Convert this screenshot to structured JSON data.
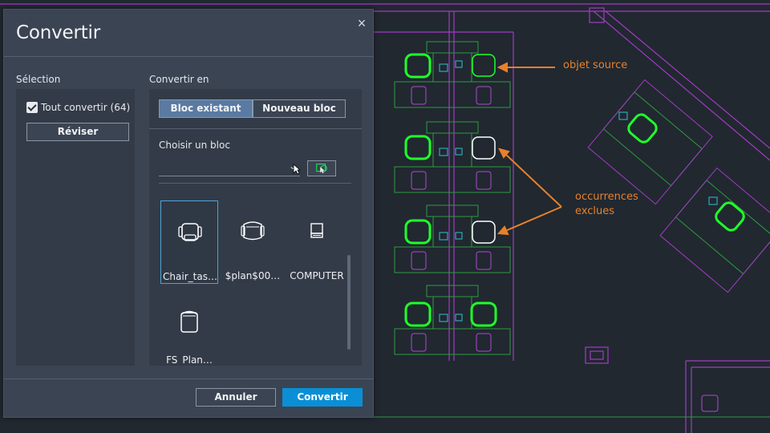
{
  "dialog": {
    "title": "Convertir",
    "close_glyph": "×",
    "selection_label": "Sélection",
    "convert_to_label": "Convertir en",
    "convert_all_label": "Tout convertir (64)",
    "convert_all_checked": true,
    "review_button": "Réviser",
    "tab_existing_block": "Bloc existant",
    "tab_new_block": "Nouveau bloc",
    "choose_block_label": "Choisir un bloc",
    "block_select_value": "",
    "blocks": [
      {
        "label": "Chair_tas…",
        "icon": "task-chair-icon",
        "selected": true
      },
      {
        "label": "$plan$00…",
        "icon": "armchair-icon",
        "selected": false
      },
      {
        "label": "COMPUTER",
        "icon": "computer-icon",
        "selected": false
      },
      {
        "label": "FS_Plan…",
        "icon": "lounge-chair-icon",
        "selected": false
      }
    ],
    "cancel_button": "Annuler",
    "convert_button": "Convertir"
  },
  "annotations": {
    "source_object": "objet source",
    "excluded_line1": "occurrences",
    "excluded_line2": "exclues"
  },
  "colors": {
    "canvas_bg": "#212830",
    "wall_magenta": "#a23bc4",
    "desk_green": "#2f9a3f",
    "chair_highlight": "#1fff2a",
    "annotation_orange": "#e8812a",
    "primary_button": "#0a8fd6",
    "active_tab": "#5a7aa1"
  }
}
